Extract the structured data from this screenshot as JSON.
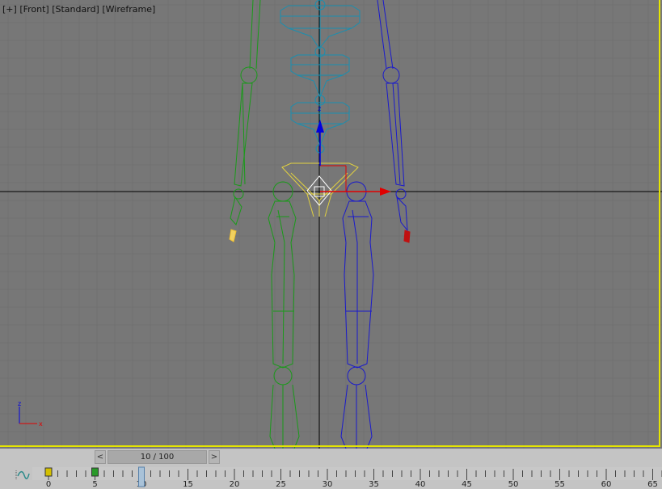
{
  "viewport": {
    "label_parts": [
      "[+]",
      "[Front]",
      "[Standard]",
      "[Wireframe]"
    ],
    "axis_labels": {
      "z": "z",
      "x": "x"
    },
    "colors": {
      "background": "#777777",
      "grid": "#707070",
      "active_border": "#e6e600",
      "spine": "#1a8fb0",
      "left_limb": "#1a9a1a",
      "right_limb": "#1a1acc",
      "pelvis": "#e0d040",
      "x_axis": "#e00000",
      "z_axis": "#0000e0",
      "crosshair": "#000000"
    }
  },
  "timeline": {
    "prev_label": "<",
    "next_label": ">",
    "frame_display": "10 / 100",
    "current_frame": 10,
    "total_frames": 100,
    "tick_labels": [
      "0",
      "5",
      "10",
      "15",
      "20",
      "25",
      "30",
      "35",
      "40",
      "45",
      "50",
      "55",
      "60",
      "65"
    ],
    "keys": [
      {
        "frame": 0,
        "color": "#d4c000"
      },
      {
        "frame": 5,
        "color": "#2a9a2a"
      }
    ],
    "curve_icon": "function-curve-icon"
  }
}
